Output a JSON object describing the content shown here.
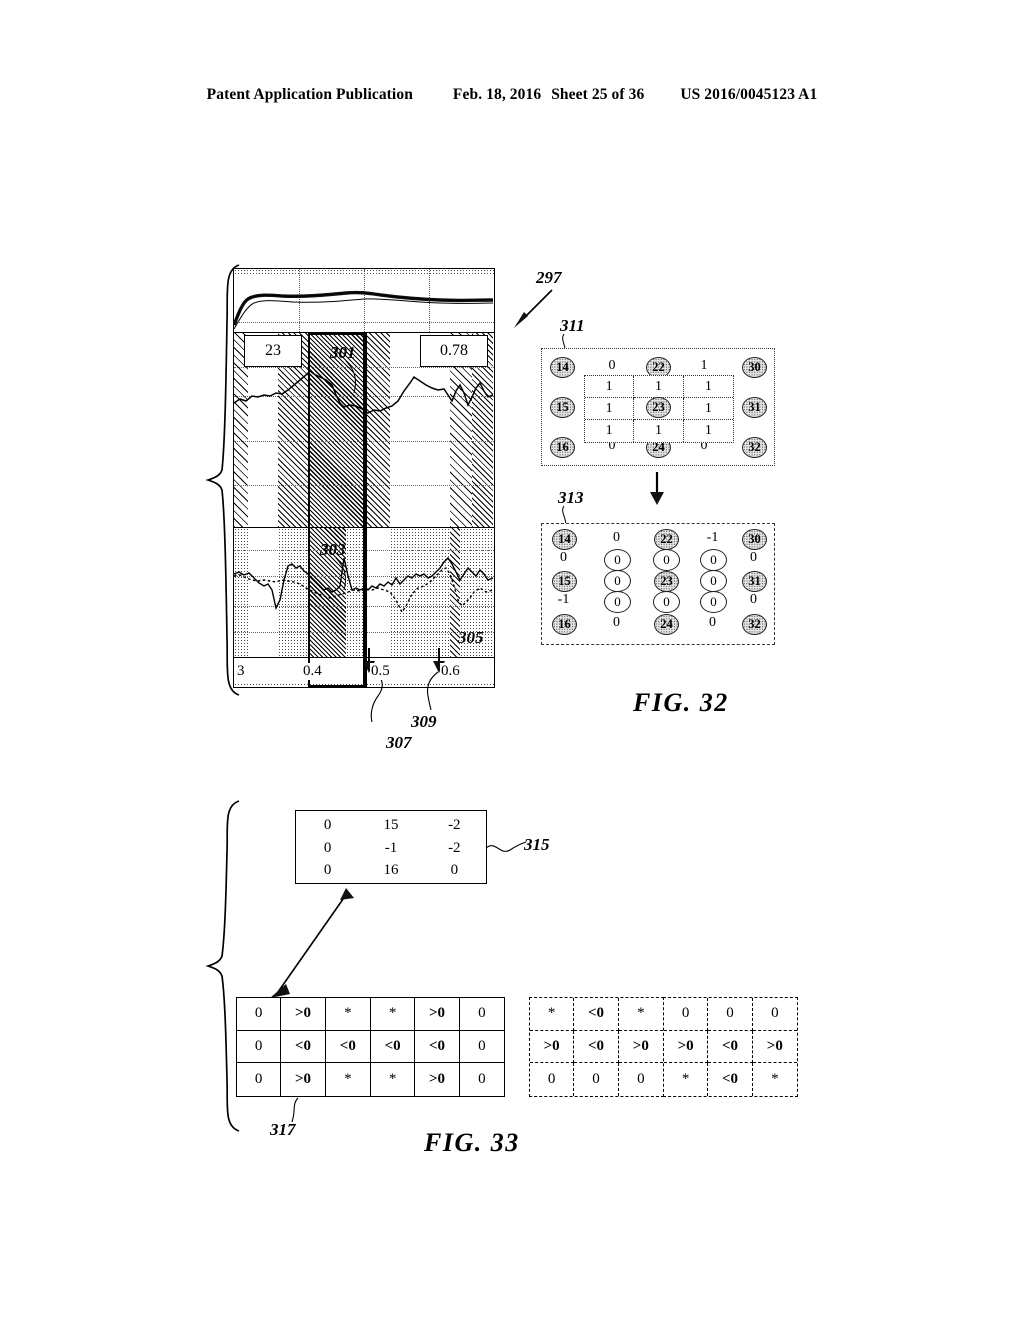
{
  "header": {
    "publication": "Patent Application Publication",
    "date": "Feb. 18, 2016",
    "sheet": "Sheet 25 of 36",
    "patent_number": "US 2016/0045123 A1"
  },
  "fig32": {
    "caption": "FIG. 32",
    "panel_ref": "297",
    "callouts": {
      "c301": "301",
      "c303": "303",
      "c305": "305",
      "c307": "307",
      "c309": "309"
    },
    "value_boxes": {
      "left": "23",
      "right": "0.78"
    },
    "axis_labels": [
      "3",
      "0.4",
      "0.5",
      "0.6"
    ],
    "matrix_311": {
      "ref": "311",
      "left_nodes": [
        "14",
        "15",
        "16"
      ],
      "right_nodes": [
        "30",
        "31",
        "32"
      ],
      "top_nodes": [
        "22"
      ],
      "bottom_nodes": [
        "24"
      ],
      "center_node": "23",
      "top_values": [
        "0",
        "1"
      ],
      "bottom_values": [
        "0",
        "0"
      ],
      "grid": [
        [
          "1",
          "1",
          "1"
        ],
        [
          "1",
          "",
          "1"
        ],
        [
          "1",
          "1",
          "1"
        ]
      ]
    },
    "matrix_313": {
      "ref": "313",
      "col1": [
        "14",
        "0",
        "15",
        "-1",
        "16"
      ],
      "col2": [
        "0",
        "0",
        "0",
        "0",
        "0"
      ],
      "col3": [
        "22",
        "0",
        "23",
        "0",
        "24"
      ],
      "col4": [
        "-1",
        "0",
        "0",
        "0",
        "0"
      ],
      "col5": [
        "30",
        "0",
        "31",
        "0",
        "32"
      ]
    }
  },
  "fig33": {
    "caption": "FIG. 33",
    "matrix_315": {
      "ref": "315",
      "rows": [
        [
          "0",
          "15",
          "-2"
        ],
        [
          "0",
          "-1",
          "-2"
        ],
        [
          "0",
          "16",
          "0"
        ]
      ]
    },
    "grid_317_ref": "317",
    "grids": [
      {
        "border": "solid",
        "cells": [
          [
            "0",
            ">0",
            "*"
          ],
          [
            "0",
            "<0",
            "<0"
          ],
          [
            "0",
            ">0",
            "*"
          ]
        ]
      },
      {
        "border": "solid",
        "cells": [
          [
            "*",
            ">0",
            "0"
          ],
          [
            "<0",
            "<0",
            "0"
          ],
          [
            "*",
            ">0",
            "0"
          ]
        ]
      },
      {
        "border": "dashed",
        "cells": [
          [
            "*",
            "<0",
            "*"
          ],
          [
            ">0",
            "<0",
            ">0"
          ],
          [
            "0",
            "0",
            "0"
          ]
        ]
      },
      {
        "border": "dashed",
        "cells": [
          [
            "0",
            "0",
            "0"
          ],
          [
            ">0",
            "<0",
            ">0"
          ],
          [
            "*",
            "<0",
            "*"
          ]
        ]
      }
    ]
  }
}
